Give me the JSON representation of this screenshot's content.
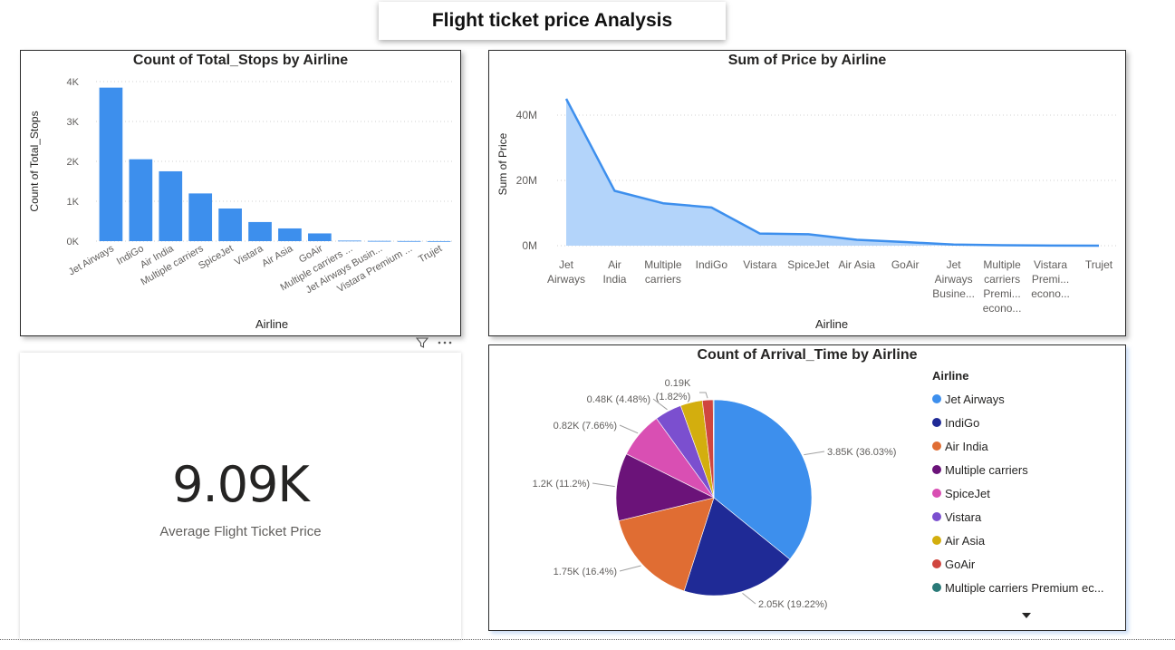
{
  "page": {
    "title": "Flight ticket price Analysis"
  },
  "colors": {
    "bar": "#3d8fed",
    "area_fill": "#b3d4fa",
    "line": "#3d8fed"
  },
  "bar_chart": {
    "title": "Count of Total_Stops by Airline",
    "ylabel": "Count of Total_Stops",
    "xlabel": "Airline",
    "yticks": [
      "0K",
      "1K",
      "2K",
      "3K",
      "4K"
    ],
    "categories": [
      "Jet Airways",
      "IndiGo",
      "Air India",
      "Multiple carriers",
      "SpiceJet",
      "Vistara",
      "Air Asia",
      "GoAir",
      "Multiple carriers ...",
      "Jet Airways Busin...",
      "Vistara Premium ...",
      "Trujet"
    ]
  },
  "area_chart": {
    "title": "Sum of Price by Airline",
    "ylabel": "Sum of Price",
    "xlabel": "Airline",
    "yticks": [
      "0M",
      "20M",
      "40M"
    ],
    "categories": [
      [
        "Jet",
        "Airways"
      ],
      [
        "Air",
        "India"
      ],
      [
        "Multiple",
        "carriers"
      ],
      [
        "IndiGo"
      ],
      [
        "Vistara"
      ],
      [
        "SpiceJet"
      ],
      [
        "Air Asia"
      ],
      [
        "GoAir"
      ],
      [
        "Jet",
        "Airways",
        "Busine..."
      ],
      [
        "Multiple",
        "carriers",
        "Premi...",
        "econo..."
      ],
      [
        "Vistara",
        "Premi...",
        "econo..."
      ],
      [
        "Trujet"
      ]
    ]
  },
  "kpi": {
    "value": "9.09K",
    "label": "Average Flight Ticket Price"
  },
  "pie_chart": {
    "title": "Count of Arrival_Time by Airline",
    "legend_title": "Airline",
    "legend": [
      {
        "label": "Jet Airways",
        "color": "#3d8fed"
      },
      {
        "label": "IndiGo",
        "color": "#1f2a96"
      },
      {
        "label": "Air India",
        "color": "#e06d33"
      },
      {
        "label": "Multiple carriers",
        "color": "#6b1379"
      },
      {
        "label": "SpiceJet",
        "color": "#d94fb3"
      },
      {
        "label": "Vistara",
        "color": "#7b4fcf"
      },
      {
        "label": "Air Asia",
        "color": "#d3ae0e"
      },
      {
        "label": "GoAir",
        "color": "#d0463f"
      },
      {
        "label": "Multiple carriers Premium ec...",
        "color": "#2a7a78"
      }
    ],
    "labels": [
      "3.85K (36.03%)",
      "2.05K (19.22%)",
      "1.75K (16.4%)",
      "1.2K (11.2%)",
      "0.82K (7.66%)",
      "0.48K (4.48%)",
      "0.19K",
      "(1.82%)"
    ]
  },
  "chart_data": [
    {
      "type": "bar",
      "title": "Count of Total_Stops by Airline",
      "xlabel": "Airline",
      "ylabel": "Count of Total_Stops",
      "categories": [
        "Jet Airways",
        "IndiGo",
        "Air India",
        "Multiple carriers",
        "SpiceJet",
        "Vistara",
        "Air Asia",
        "GoAir",
        "Multiple carriers Premium economy",
        "Jet Airways Business",
        "Vistara Premium economy",
        "Trujet"
      ],
      "values": [
        3849,
        2053,
        1751,
        1196,
        818,
        479,
        319,
        194,
        13,
        6,
        3,
        1
      ],
      "ylim": [
        0,
        4000
      ],
      "grid": true
    },
    {
      "type": "area",
      "title": "Sum of Price by Airline",
      "xlabel": "Airline",
      "ylabel": "Sum of Price",
      "categories": [
        "Jet Airways",
        "Air India",
        "Multiple carriers",
        "IndiGo",
        "Vistara",
        "SpiceJet",
        "Air Asia",
        "GoAir",
        "Jet Airways Business",
        "Multiple carriers Premium economy",
        "Vistara Premium economy",
        "Trujet"
      ],
      "values": [
        45000000,
        16800000,
        13000000,
        11700000,
        3700000,
        3500000,
        1800000,
        1100000,
        350000,
        150000,
        25000,
        4000
      ],
      "ylim": [
        0,
        45000000
      ],
      "grid": true
    },
    {
      "type": "pie",
      "title": "Count of Arrival_Time by Airline",
      "categories": [
        "Jet Airways",
        "IndiGo",
        "Air India",
        "Multiple carriers",
        "SpiceJet",
        "Vistara",
        "Air Asia",
        "GoAir",
        "Multiple carriers Premium economy"
      ],
      "values": [
        3850,
        2050,
        1750,
        1200,
        820,
        480,
        390,
        190,
        13
      ],
      "percentages": [
        36.03,
        19.22,
        16.4,
        11.2,
        7.66,
        4.48,
        3.6,
        1.82,
        0.12
      ],
      "legend": "right"
    }
  ]
}
